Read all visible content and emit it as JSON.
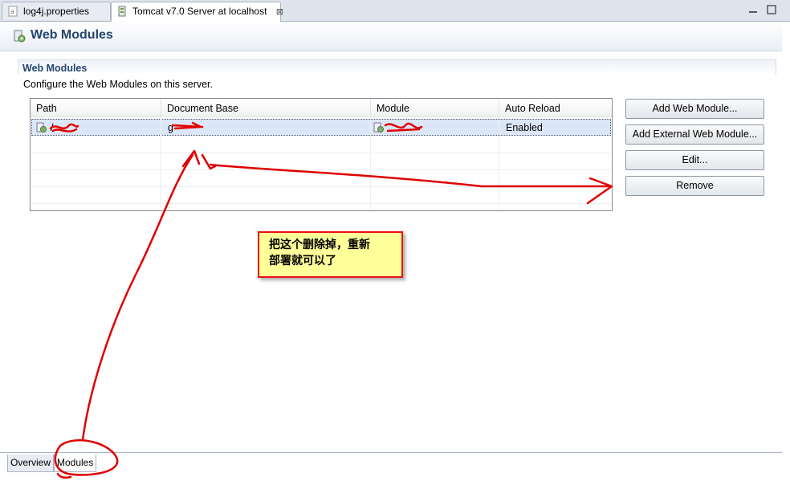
{
  "tabs": [
    {
      "label": "log4j.properties",
      "active": false
    },
    {
      "label": "Tomcat v7.0 Server at localhost",
      "active": true,
      "close": "⊠"
    }
  ],
  "header": {
    "title": "Web Modules"
  },
  "section": {
    "title": "Web Modules",
    "description": "Configure the Web Modules on this server."
  },
  "table": {
    "columns": [
      "Path",
      "Document Base",
      "Module",
      "Auto Reload"
    ],
    "rows": [
      {
        "path": "/",
        "document_base": "g",
        "module": "",
        "auto_reload": "Enabled"
      }
    ]
  },
  "buttons": {
    "add_web_module": "Add Web Module...",
    "add_external": "Add External Web Module...",
    "edit": "Edit...",
    "remove": "Remove"
  },
  "callout": {
    "line1": "把这个删除掉，重新",
    "line2": "部署就可以了"
  },
  "bottom_tabs": [
    {
      "label": "Overview",
      "active": false
    },
    {
      "label": "Modules",
      "active": true
    }
  ],
  "colors": {
    "annotation": "#e00000",
    "callout_bg": "#ffff99",
    "title": "#24466e"
  }
}
